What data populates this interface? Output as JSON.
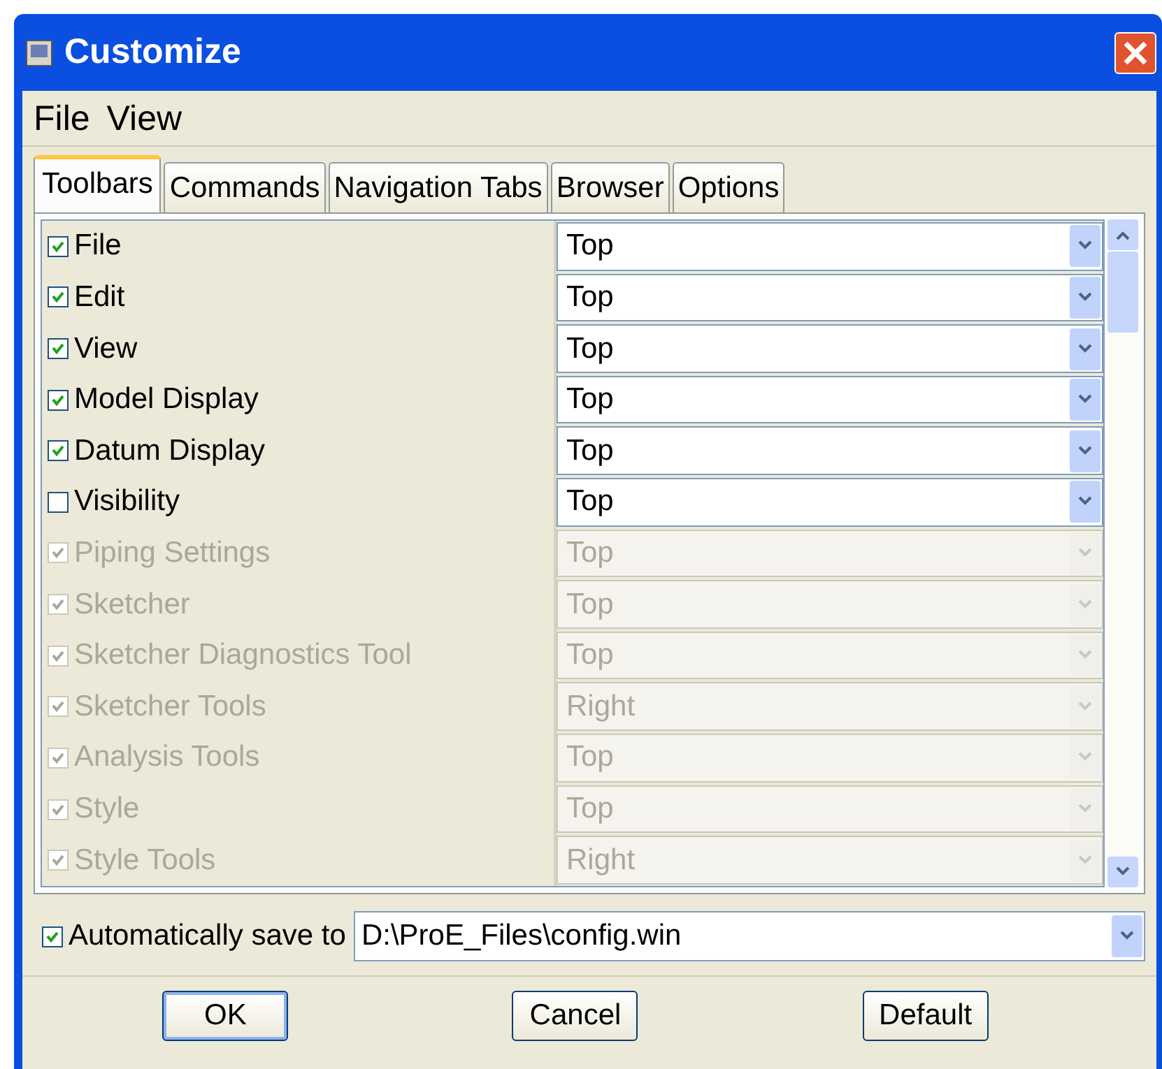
{
  "window": {
    "title": "Customize"
  },
  "menu": [
    {
      "label": "File"
    },
    {
      "label": "View"
    }
  ],
  "tabs": [
    {
      "label": "Toolbars",
      "selected": true
    },
    {
      "label": "Commands",
      "selected": false
    },
    {
      "label": "Navigation Tabs",
      "selected": false
    },
    {
      "label": "Browser",
      "selected": false
    },
    {
      "label": "Options",
      "selected": false
    }
  ],
  "toolbars": [
    {
      "name": "File",
      "checked": true,
      "disabled": false,
      "position": "Top"
    },
    {
      "name": "Edit",
      "checked": true,
      "disabled": false,
      "position": "Top"
    },
    {
      "name": "View",
      "checked": true,
      "disabled": false,
      "position": "Top"
    },
    {
      "name": "Model Display",
      "checked": true,
      "disabled": false,
      "position": "Top"
    },
    {
      "name": "Datum Display",
      "checked": true,
      "disabled": false,
      "position": "Top"
    },
    {
      "name": "Visibility",
      "checked": false,
      "disabled": false,
      "position": "Top"
    },
    {
      "name": "Piping Settings",
      "checked": true,
      "disabled": true,
      "position": "Top"
    },
    {
      "name": "Sketcher",
      "checked": true,
      "disabled": true,
      "position": "Top"
    },
    {
      "name": "Sketcher Diagnostics Tool",
      "checked": true,
      "disabled": true,
      "position": "Top"
    },
    {
      "name": "Sketcher Tools",
      "checked": true,
      "disabled": true,
      "position": "Right"
    },
    {
      "name": "Analysis Tools",
      "checked": true,
      "disabled": true,
      "position": "Top"
    },
    {
      "name": "Style",
      "checked": true,
      "disabled": true,
      "position": "Top"
    },
    {
      "name": "Style Tools",
      "checked": true,
      "disabled": true,
      "position": "Right"
    }
  ],
  "autosave": {
    "label": "Automatically save to",
    "checked": true,
    "path": "D:\\ProE_Files\\config.win"
  },
  "buttons": [
    {
      "label": "OK",
      "default": true
    },
    {
      "label": "Cancel",
      "default": false
    },
    {
      "label": "Default",
      "default": false
    }
  ]
}
